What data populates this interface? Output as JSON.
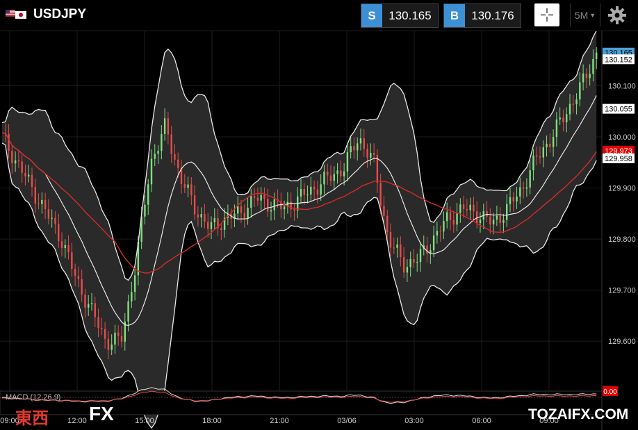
{
  "header": {
    "symbol": "USDJPY",
    "flag_icon": "us-japan-flag-icon",
    "sell": {
      "tag": "S",
      "price": "130.165"
    },
    "buy": {
      "tag": "B",
      "price": "130.176"
    },
    "crosshair_icon": "crosshair-icon",
    "timeframe": "5M",
    "settings_icon": "gear-icon",
    "accent_color": "#3d8fd6"
  },
  "chart_data": {
    "type": "candlestick",
    "y_ticks": [
      "130.100",
      "130.000",
      "129.900",
      "129.800",
      "129.700",
      "129.600"
    ],
    "x_ticks": [
      "09:00",
      "12:00",
      "15:00",
      "18:00",
      "21:00",
      "03/06",
      "03:00",
      "06:00",
      "09:00"
    ],
    "ylim": [
      129.52,
      130.2
    ],
    "price_labels": [
      {
        "value": "130.165",
        "color": "#4aa0d9",
        "text_color": "#000"
      },
      {
        "value": "130.152",
        "color": "#ffffff",
        "text_color": "#000"
      },
      {
        "value": "130.055",
        "color": "#ffffff",
        "text_color": "#000"
      },
      {
        "value": "129.973",
        "color": "#e00000",
        "text_color": "#fff"
      },
      {
        "value": "129.958",
        "color": "#ffffff",
        "text_color": "#000"
      }
    ],
    "indicators": [
      "Bollinger Bands",
      "Moving Average"
    ],
    "close_path": [
      130.0,
      129.95,
      129.9,
      129.85,
      129.8,
      129.72,
      129.66,
      129.6,
      129.6,
      129.75,
      129.95,
      130.02,
      129.92,
      129.86,
      129.82,
      129.84,
      129.85,
      129.88,
      129.87,
      129.86,
      129.88,
      129.9,
      129.92,
      129.94,
      130.0,
      129.95,
      129.8,
      129.75,
      129.76,
      129.8,
      129.84,
      129.86,
      129.85,
      129.83,
      129.86,
      129.9,
      129.96,
      130.0,
      130.05,
      130.1,
      130.165
    ]
  },
  "macd": {
    "label": "MACD (12,26,9)",
    "value_badge": "0.00"
  },
  "watermark": {
    "left_text": "東西",
    "fx_text": "FX",
    "right_text": "TOZAIFX.COM"
  }
}
